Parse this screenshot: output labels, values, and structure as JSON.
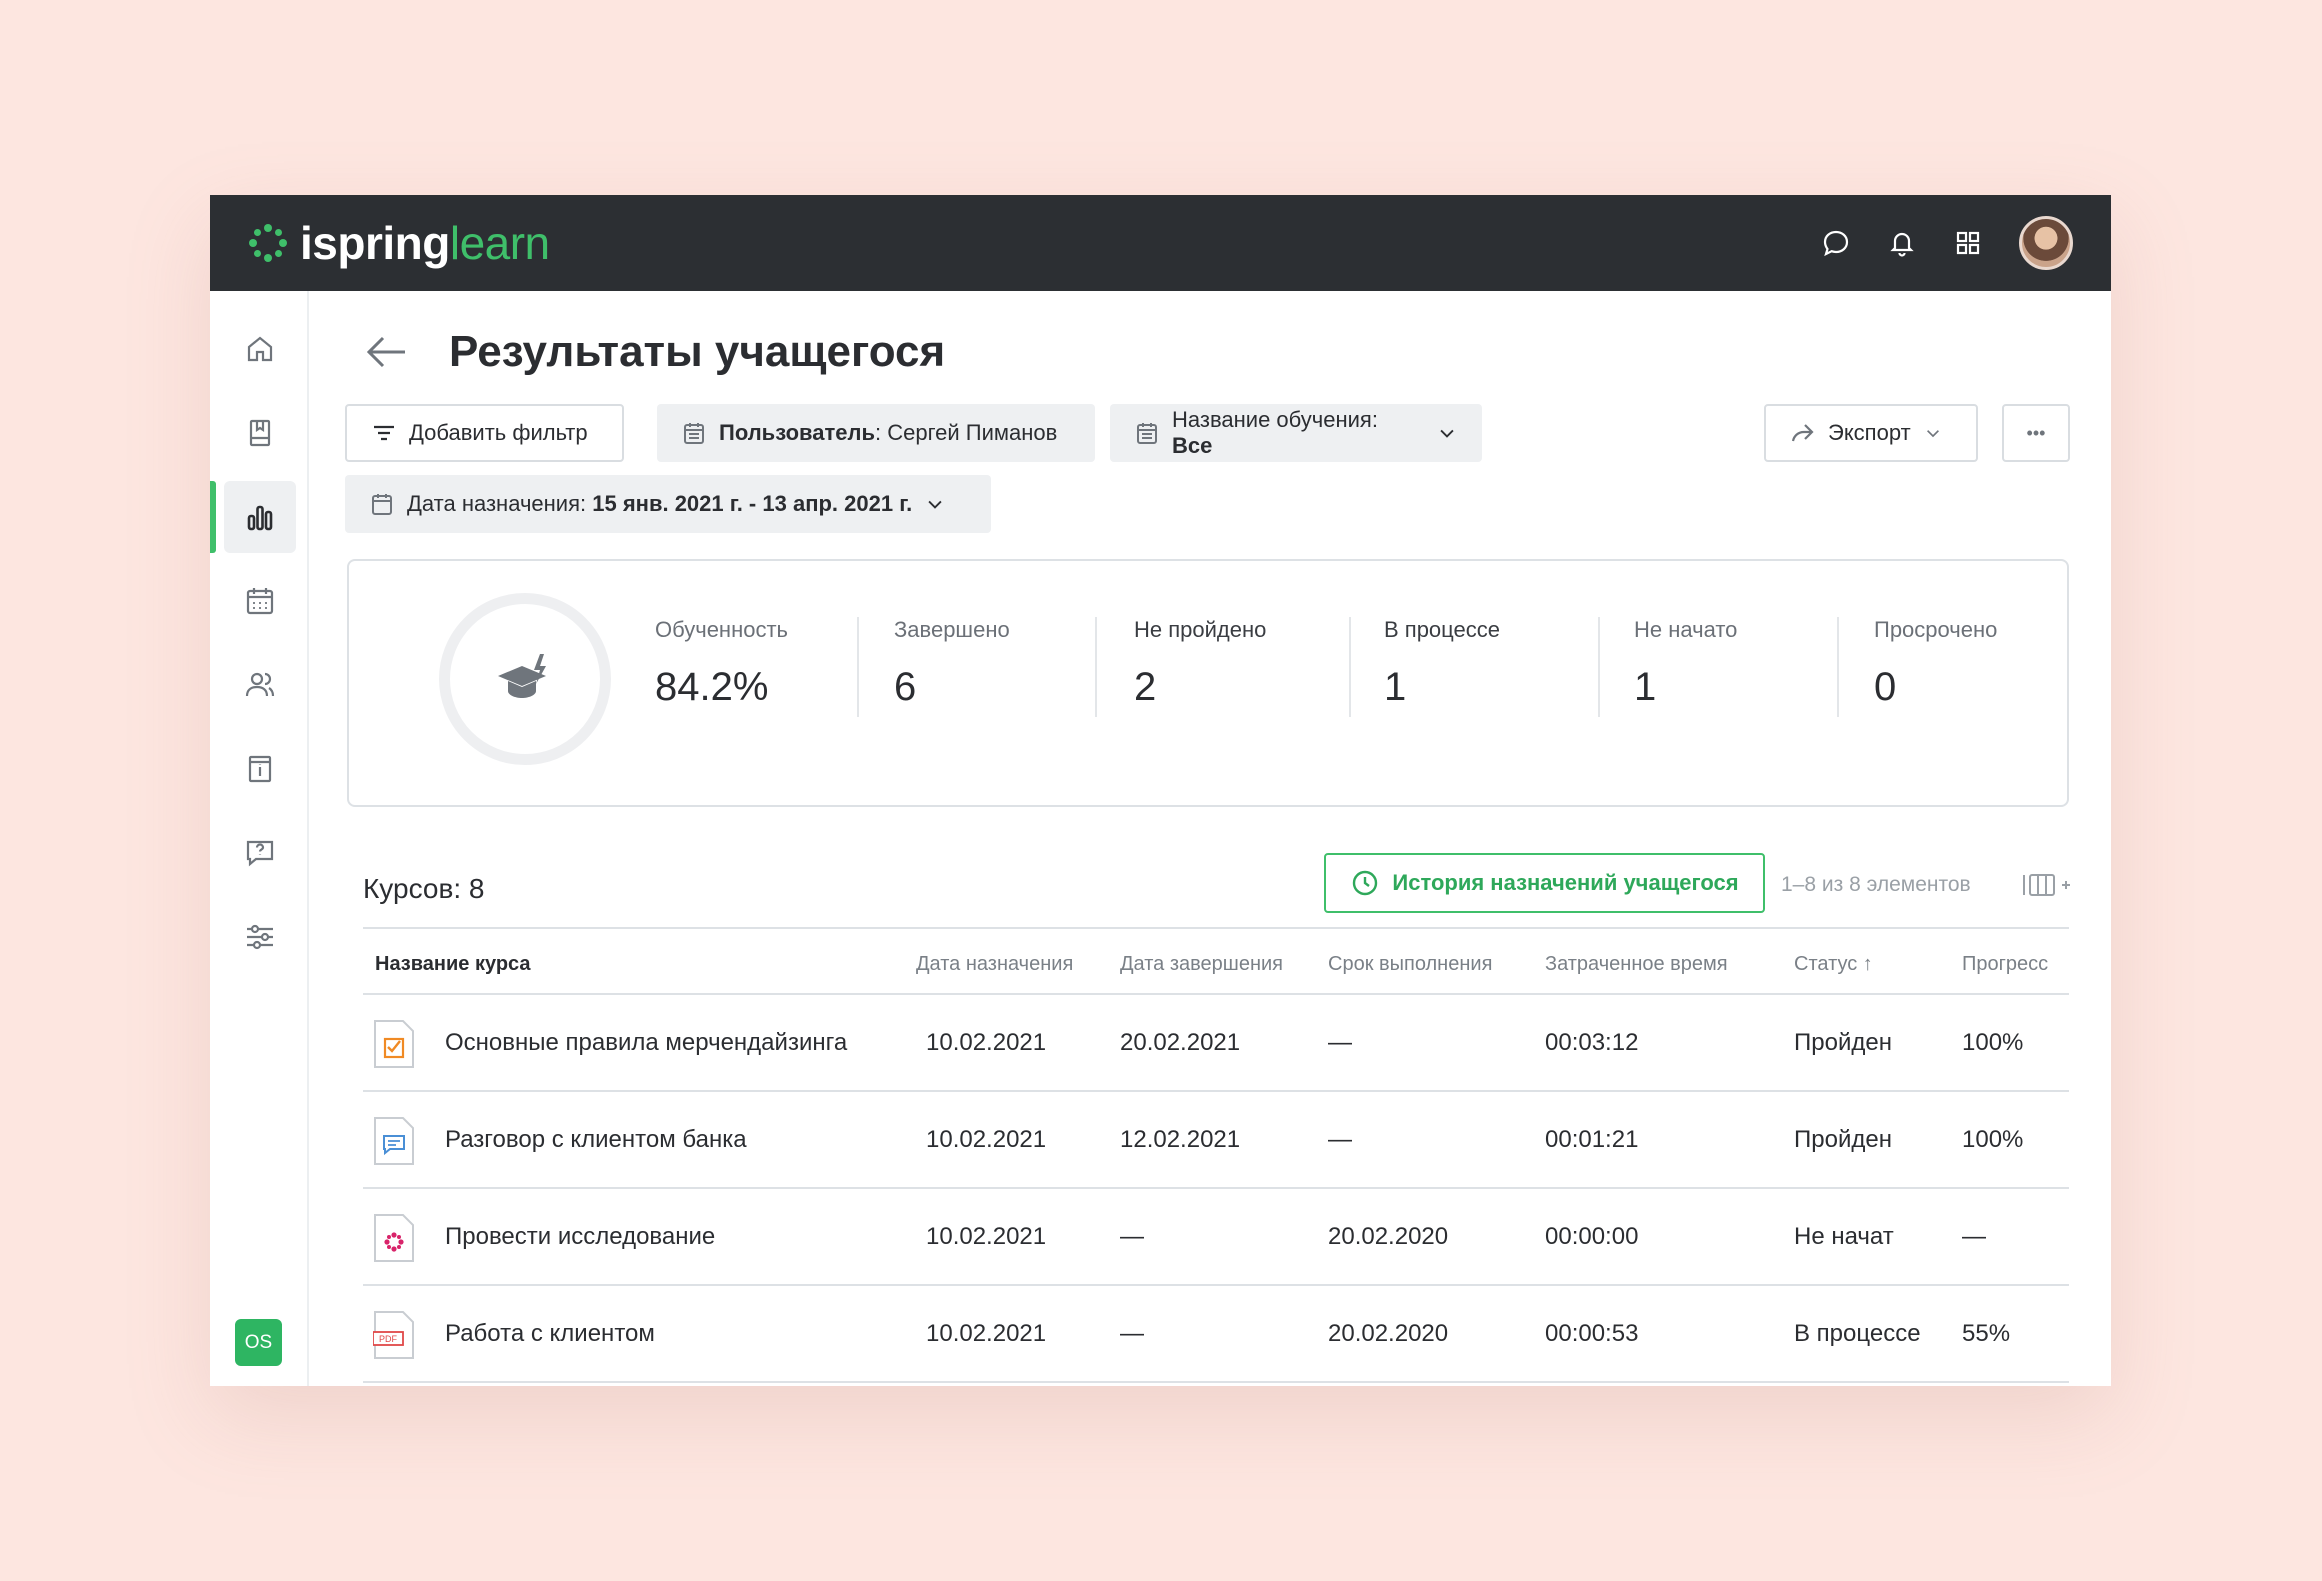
{
  "brand": {
    "name_a": "ispring",
    "name_b": "learn",
    "accent": "#3fbf6a"
  },
  "topbar": {
    "icons": [
      "chat-icon",
      "bell-icon",
      "apps-grid-icon",
      "avatar"
    ]
  },
  "sidebar": {
    "items": [
      "home-icon",
      "library-icon",
      "reports-icon",
      "calendar-icon",
      "users-icon",
      "info-icon",
      "question-icon",
      "settings-icon"
    ],
    "active": "reports-icon",
    "badge": "OS"
  },
  "page": {
    "title": "Результаты учащегося"
  },
  "filters": {
    "add_filter": "Добавить фильтр",
    "user_label": "Пользователь",
    "user_value": ": Сергей Пиманов",
    "training_label": "Название обучения: ",
    "training_value": "Все",
    "date_label": "Дата назначения: ",
    "date_value": "15 янв. 2021 г. - 13 апр. 2021 г."
  },
  "actions": {
    "export": "Экспорт",
    "more": "•••"
  },
  "stats": [
    {
      "label": "Обученность",
      "value": "84.2%"
    },
    {
      "label": "Завершено",
      "value": "6"
    },
    {
      "label": "Не пройдено",
      "value": "2"
    },
    {
      "label": "В процессе",
      "value": "1"
    },
    {
      "label": "Не начато",
      "value": "1"
    },
    {
      "label": "Просрочено",
      "value": "0"
    }
  ],
  "courses": {
    "count_label": "Курсов: 8",
    "history_button": "История назначений учащегося",
    "pager": "1–8 из 8 элементов"
  },
  "table": {
    "columns": [
      "Название курса",
      "Дата назначения",
      "Дата завершения",
      "Срок выполнения",
      "Затраченное время",
      "Статус ↑",
      "Прогресс"
    ],
    "rows": [
      {
        "icon": "quiz-icon",
        "name": "Основные правила мерчендайзинга",
        "assigned": "10.02.2021",
        "completed": "20.02.2021",
        "due": "—",
        "time": "00:03:12",
        "status": "Пройден",
        "progress": "100%"
      },
      {
        "icon": "dialog-icon",
        "name": "Разговор с клиентом банка",
        "assigned": "10.02.2021",
        "completed": "12.02.2021",
        "due": "—",
        "time": "00:01:21",
        "status": "Пройден",
        "progress": "100%"
      },
      {
        "icon": "ispring-course-icon",
        "name": "Провести  исследование",
        "assigned": "10.02.2021",
        "completed": "—",
        "due": "20.02.2020",
        "time": "00:00:00",
        "status": "Не начат",
        "progress": "—"
      },
      {
        "icon": "pdf-icon",
        "name": "Работа с клиентом",
        "assigned": "10.02.2021",
        "completed": "—",
        "due": "20.02.2020",
        "time": "00:00:53",
        "status": "В процессе",
        "progress": "55%"
      }
    ]
  }
}
